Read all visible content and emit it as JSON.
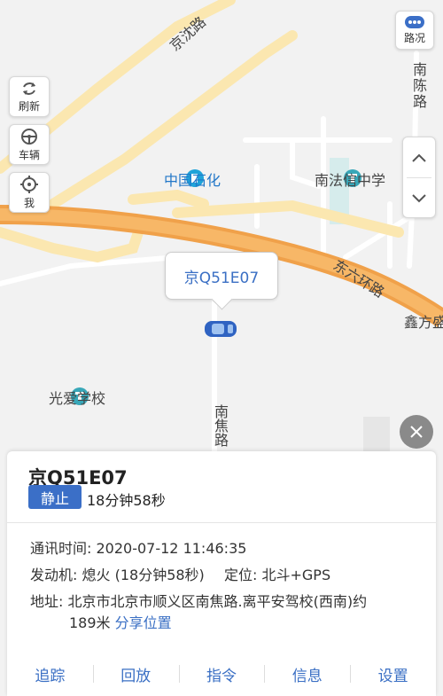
{
  "map": {
    "labels": {
      "jingshen_road": "京沈路",
      "nanchen_road": "南陈路",
      "sinopec": "中国石化",
      "nanfaxin_school": "南法信中学",
      "east_sixth_ring": "东六环路",
      "xinfangsheng": "鑫方盛",
      "guangai_school": "光爱学校",
      "nanjiao_road": "南焦路"
    },
    "vehicle_callout": "京Q51E07"
  },
  "controls": {
    "traffic": "路况",
    "refresh": "刷新",
    "vehicle": "车辆",
    "me": "我"
  },
  "panel": {
    "plate": "京Q51E07",
    "status_badge": "静止",
    "status_duration": "18分钟58秒",
    "comm_time_label": "通讯时间:",
    "comm_time": "2020-07-12 11:46:35",
    "engine_label": "发动机:",
    "engine": "熄火 (18分钟58秒)",
    "location_label": "定位:",
    "location": "北斗+GPS",
    "address_label": "地址:",
    "address_line1": "北京市北京市顺义区南焦路.离平安驾校(西南)约",
    "address_line2": "189米",
    "share": "分享位置",
    "actions": [
      "追踪",
      "回放",
      "指令",
      "信息",
      "设置"
    ]
  },
  "colors": {
    "accent": "#3b6fc7",
    "highway": "#f0a14a",
    "major_road": "#fbe7b0",
    "map_bg": "#f2f2f2"
  }
}
